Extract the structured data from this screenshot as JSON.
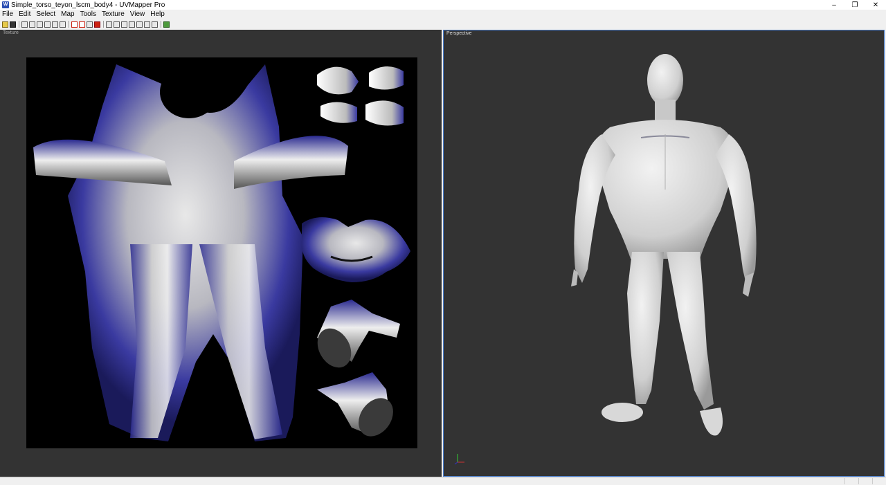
{
  "window": {
    "title": "Simple_torso_teyon_lscm_body4 - UVMapper Pro",
    "app_icon_text": "W",
    "minimize": "–",
    "restore": "❐",
    "close": "✕"
  },
  "menu": {
    "items": [
      "File",
      "Edit",
      "Select",
      "Map",
      "Tools",
      "Texture",
      "View",
      "Help"
    ]
  },
  "toolbar": {
    "icons": [
      "open-icon",
      "save-icon",
      "select-arrow-icon",
      "pan-hand-icon",
      "zoom-icon",
      "marquee-select-icon",
      "lasso-icon",
      "magic-wand-icon",
      "grid-select-icon",
      "deselect-icon",
      "invert-select-icon",
      "delete-select-icon",
      "box-icon",
      "cylinder-icon",
      "cube-icon",
      "sphere-icon",
      "circle-icon",
      "polar-icon",
      "settings-icon"
    ]
  },
  "viewports": {
    "texture_label": "Texture",
    "perspective_label": "Perspective"
  },
  "colors": {
    "viewport_bg": "#333333",
    "uv_blue": "#2a2a9a",
    "active_border": "#4a7fd0"
  }
}
